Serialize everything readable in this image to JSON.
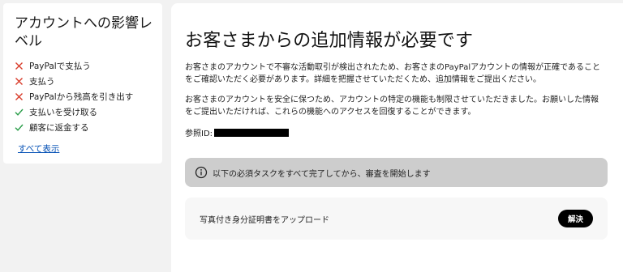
{
  "sidebar": {
    "title": "アカウントへの影響レベル",
    "items": [
      {
        "label": "PayPalで支払う",
        "status": "blocked",
        "icon": "cross-icon"
      },
      {
        "label": "支払う",
        "status": "blocked",
        "icon": "cross-icon"
      },
      {
        "label": "PayPalから残高を引き出す",
        "status": "blocked",
        "icon": "cross-icon"
      },
      {
        "label": "支払いを受け取る",
        "status": "allowed",
        "icon": "check-icon"
      },
      {
        "label": "顧客に返金する",
        "status": "allowed",
        "icon": "check-icon"
      }
    ],
    "show_all_label": "すべて表示"
  },
  "main": {
    "title": "お客さまからの追加情報が必要です",
    "paragraph1": "お客さまのアカウントで不審な活動取引が検出されたため、お客さまのPayPalアカウントの情報が正確であることをご確認いただく必要があります。詳細を把握させていただくため、追加情報をご提出ください。",
    "paragraph2": "お客さまのアカウントを安全に保つため、アカウントの特定の機能も制限させていただきました。お願いした情報をご提出いただければ、これらの機能へのアクセスを回復することができます。",
    "reference_label": "参照ID:",
    "alert_text": "以下の必須タスクをすべて完了してから、審査を開始します",
    "task_label": "写真付き身分証明書をアップロード",
    "resolve_label": "解決"
  },
  "colors": {
    "blocked": "#d93d2b",
    "allowed": "#2c9e4b",
    "link": "#0551b5",
    "alert_bg": "#cdcdcd",
    "button_bg": "#000000"
  }
}
